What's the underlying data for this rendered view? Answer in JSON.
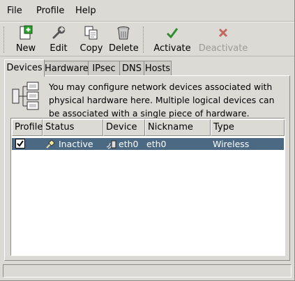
{
  "menubar": {
    "items": [
      {
        "label": "File"
      },
      {
        "label": "Profile"
      },
      {
        "label": "Help"
      }
    ]
  },
  "toolbar": {
    "new": {
      "label": "New",
      "icon": "new-icon"
    },
    "edit": {
      "label": "Edit",
      "icon": "edit-wrench-icon"
    },
    "copy": {
      "label": "Copy",
      "icon": "copy-icon"
    },
    "delete": {
      "label": "Delete",
      "icon": "trash-icon"
    },
    "activate": {
      "label": "Activate",
      "icon": "checkmark-icon"
    },
    "deactivate": {
      "label": "Deactivate",
      "icon": "x-icon",
      "disabled": true
    }
  },
  "tabs": [
    {
      "label": "Devices",
      "active": true
    },
    {
      "label": "Hardware"
    },
    {
      "label": "IPsec"
    },
    {
      "label": "DNS"
    },
    {
      "label": "Hosts"
    }
  ],
  "info": {
    "text": "You may configure network devices associated with physical hardware here.  Multiple logical devices can be associated with a single piece of hardware."
  },
  "table": {
    "columns": [
      "Profile",
      "Status",
      "Device",
      "Nickname",
      "Type"
    ],
    "rows": [
      {
        "profile_checked": true,
        "status": "Inactive",
        "device": "eth0",
        "nickname": "eth0",
        "type": "Wireless",
        "selected": true
      }
    ]
  },
  "statusbar": {
    "text": ""
  },
  "colors": {
    "selection": "#4b6983",
    "activate": "#2e8b2e",
    "deactivate": "#c0392b"
  }
}
